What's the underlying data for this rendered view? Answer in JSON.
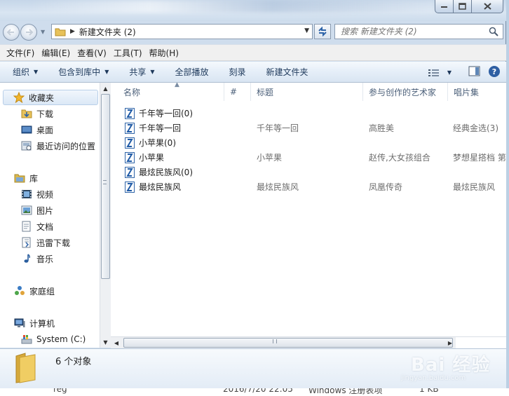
{
  "window": {
    "controls": [
      "minimize",
      "maximize",
      "close"
    ]
  },
  "address": {
    "path_current": "新建文件夹 (2)",
    "search_placeholder": "搜索 新建文件夹 (2)"
  },
  "menubar": {
    "items": [
      "文件(F)",
      "编辑(E)",
      "查看(V)",
      "工具(T)",
      "帮助(H)"
    ]
  },
  "toolbar": {
    "organize": "组织",
    "include_in_library": "包含到库中",
    "share": "共享",
    "play_all": "全部播放",
    "burn": "刻录",
    "new_folder": "新建文件夹"
  },
  "navpane": {
    "favorites": "收藏夹",
    "downloads": "下载",
    "desktop": "桌面",
    "recent": "最近访问的位置",
    "libraries": "库",
    "videos": "视频",
    "pictures": "图片",
    "documents": "文档",
    "xunlei": "迅雷下载",
    "music": "音乐",
    "homegroup": "家庭组",
    "computer": "计算机",
    "system_c": "System (C:)"
  },
  "columns": {
    "name": "名称",
    "number": "#",
    "title": "标题",
    "artists": "参与创作的艺术家",
    "album": "唱片集"
  },
  "files": [
    {
      "name": "千年等一回(0)",
      "title": "",
      "artist": "",
      "album": ""
    },
    {
      "name": "千年等一回",
      "title": "千年等一回",
      "artist": "高胜美",
      "album": "经典金选(3)"
    },
    {
      "name": "小苹果(0)",
      "title": "",
      "artist": "",
      "album": ""
    },
    {
      "name": "小苹果",
      "title": "小苹果",
      "artist": "赵传,大女孩组合",
      "album": "梦想星搭档 第"
    },
    {
      "name": "最炫民族风(0)",
      "title": "",
      "artist": "",
      "album": ""
    },
    {
      "name": "最炫民族风",
      "title": "最炫民族风",
      "artist": "凤凰传奇",
      "album": "最炫民族风"
    }
  ],
  "details": {
    "count": "6 个对象"
  },
  "background_row": {
    "name": "reg",
    "date": "2016/7/20 22:05",
    "type": "Windows 注册表项",
    "size": "1 KB"
  },
  "watermark": {
    "brand": "Bai 经验",
    "url": "jingyan.baidu.com"
  },
  "colors": {
    "accent": "#1e395b",
    "dim_text": "#6d6d6d"
  }
}
